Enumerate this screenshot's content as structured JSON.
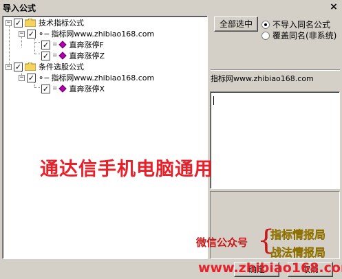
{
  "window": {
    "title": "导入公式",
    "close_glyph": "×"
  },
  "tree": {
    "items": [
      {
        "label": "技术指标公式",
        "checked": true,
        "expander": "−"
      },
      {
        "label": "指标网www.zhibiao168.com",
        "checked": true,
        "expander": "−"
      },
      {
        "label": "直奔涨停F",
        "checked": true
      },
      {
        "label": "直奔涨停Z",
        "checked": true
      },
      {
        "label": "条件选股公式",
        "checked": true,
        "expander": "−"
      },
      {
        "label": "指标网www.zhibiao168.com",
        "checked": true,
        "expander": "−"
      },
      {
        "label": "直奔涨停X",
        "checked": true
      }
    ],
    "check_glyph": "✓"
  },
  "controls": {
    "select_all_label": "全部选中",
    "radio_skip_label": "不导入同名公式",
    "radio_overwrite_label": "覆盖同名(非系统)",
    "selected_radio": "skip",
    "source_label": "指标网www.zhibiao168.com"
  },
  "buttons": {
    "ok_label": "确定",
    "cancel_label": "取消"
  },
  "overlay": {
    "main_text": "通达信手机电脑通用",
    "wechat_label": "微信公众号",
    "wechat_line1": "指标情报局",
    "wechat_line2": "战法情报局",
    "url_text": "www.zhibiao168.com",
    "colors": {
      "red": "#e8202a",
      "gold": "#c8a400"
    }
  }
}
